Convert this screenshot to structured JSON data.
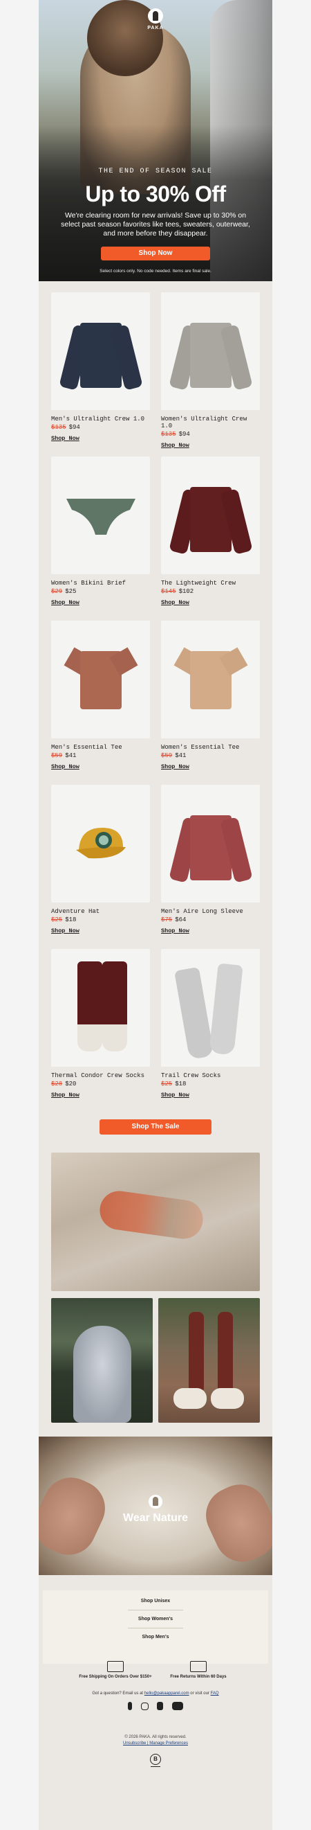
{
  "brand": {
    "name": "PAKA"
  },
  "hero": {
    "eyebrow": "THE END OF SEASON SALE",
    "headline": "Up to 30% Off",
    "subcopy": "We're clearing room for new arrivals! Save up to 30% on select past season favorites like tees, sweaters, outerwear, and more before they disappear.",
    "cta": "Shop Now",
    "fineprint": "Select colors only. No code needed. Items are final sale."
  },
  "products": [
    {
      "name": "Men's Ultralight Crew 1.0",
      "old_price": "$135",
      "price": "$94",
      "cta": "Shop Now"
    },
    {
      "name": "Women's Ultralight Crew 1.0",
      "old_price": "$135",
      "price": "$94",
      "cta": "Shop Now"
    },
    {
      "name": "Women's Bikini Brief",
      "old_price": "$29",
      "price": "$25",
      "cta": "Shop Now"
    },
    {
      "name": "The Lightweight Crew",
      "old_price": "$145",
      "price": "$102",
      "cta": "Shop Now"
    },
    {
      "name": "Men's Essential Tee",
      "old_price": "$59",
      "price": "$41",
      "cta": "Shop Now"
    },
    {
      "name": "Women's Essential Tee",
      "old_price": "$59",
      "price": "$41",
      "cta": "Shop Now"
    },
    {
      "name": "Adventure Hat",
      "old_price": "$25",
      "price": "$18",
      "cta": "Shop Now"
    },
    {
      "name": "Men's Aire Long Sleeve",
      "old_price": "$75",
      "price": "$64",
      "cta": "Shop Now"
    },
    {
      "name": "Thermal Condor Crew Socks",
      "old_price": "$28",
      "price": "$20",
      "cta": "Shop Now"
    },
    {
      "name": "Trail Crew Socks",
      "old_price": "$25",
      "price": "$18",
      "cta": "Shop Now"
    }
  ],
  "sale_cta": "Shop The Sale",
  "tagline": "Wear Nature",
  "footer": {
    "links": [
      "Shop Unisex",
      "Shop Women's",
      "Shop Men's"
    ],
    "benefits": [
      {
        "icon": "truck-icon",
        "text": "Free Shipping On Orders Over $150+"
      },
      {
        "icon": "return-box-icon",
        "text": "Free Returns Within 60 Days"
      }
    ],
    "question_prefix": "Got a question? Email us at",
    "question_email": "hello@pakaapparel.com",
    "question_mid": "or visit our",
    "question_faq": "FAQ",
    "copyright": "© 2026 PAKA. All rights reserved.",
    "unsubscribe": "Unsubscribe",
    "separator": "|",
    "preferences": "Manage Preferences",
    "social": [
      "facebook-icon",
      "instagram-icon",
      "tiktok-icon",
      "youtube-icon"
    ]
  },
  "colors": {
    "accent": "#f15a29",
    "sale_red": "#e0462b",
    "background": "#ebe8e3"
  }
}
